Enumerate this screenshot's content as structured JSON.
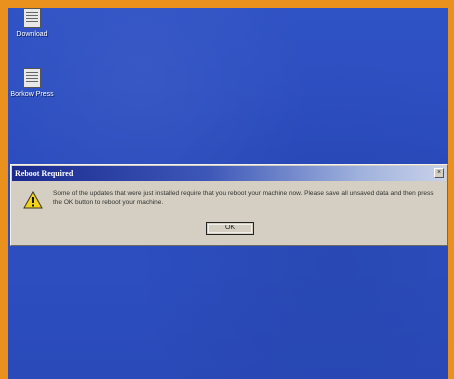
{
  "desktop": {
    "icons": [
      {
        "label": "Download",
        "icon": "document-icon"
      },
      {
        "label": "Borkow Press",
        "icon": "document-icon"
      }
    ]
  },
  "dialog": {
    "title": "Reboot Required",
    "close_glyph": "×",
    "icon": "warning-icon",
    "message": "Some of the updates that were just installed require that you reboot your machine now. Please save all unsaved data and then press the OK button to reboot your machine.",
    "ok_label": "OK"
  },
  "colors": {
    "frame": "#e9901d",
    "desktop": "#2c4ebf",
    "title_gradient_start": "#1a2a8e",
    "dialog_face": "#d4cfc2",
    "warning_yellow": "#f2d21b"
  }
}
